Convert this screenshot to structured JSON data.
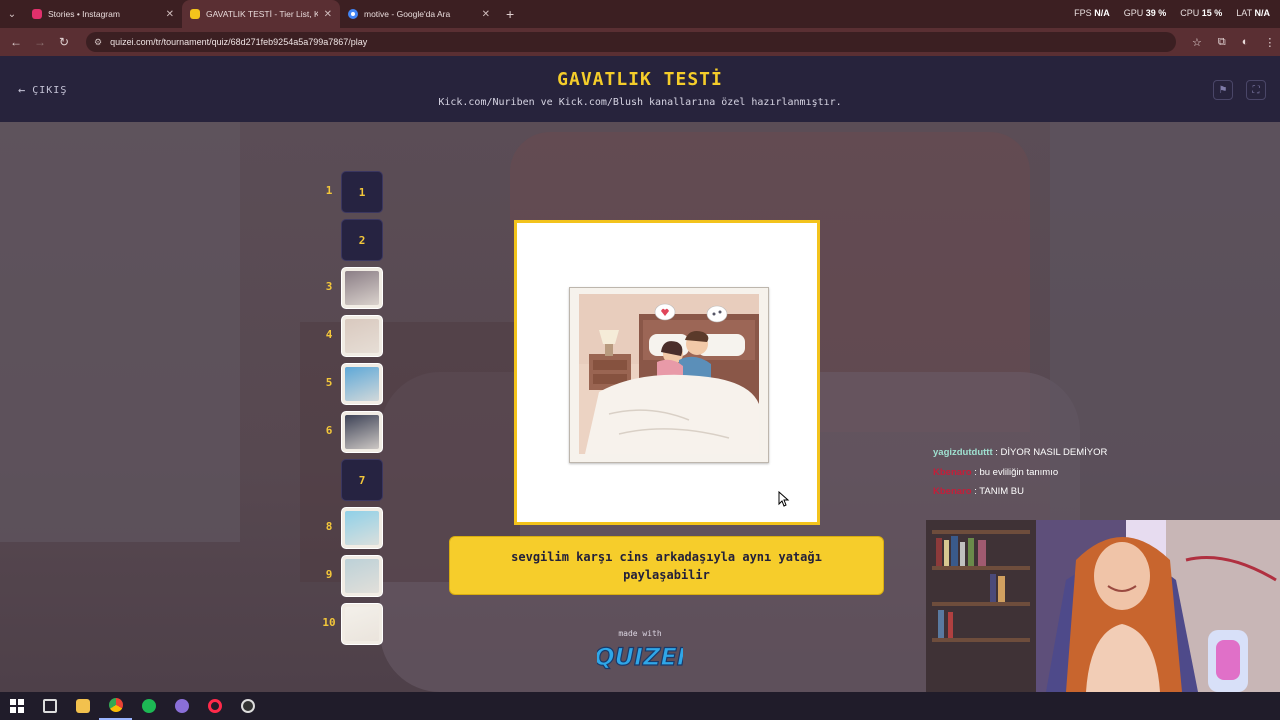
{
  "browser": {
    "tabs": [
      {
        "title": "Stories • Instagram",
        "favicon_color": "#e1306c",
        "active": false
      },
      {
        "title": "GAVATLIK TESTİ - Tier List, Kör",
        "favicon_color": "#f3c31c",
        "active": true
      },
      {
        "title": "motive - Google'da Ara",
        "favicon_color": "#4285f4",
        "active": false
      }
    ],
    "new_tab": "+",
    "url": "quizei.com/tr/tournament/quiz/68d271feb9254a5a799a7867/play",
    "hud": {
      "fps_label": "FPS",
      "fps_value": "N/A",
      "gpu_label": "GPU",
      "gpu_value": "39 %",
      "cpu_label": "CPU",
      "cpu_value": "15 %",
      "lat_label": "LAT",
      "lat_value": "N/A"
    }
  },
  "page": {
    "exit_label": "ÇIKIŞ",
    "title": "GAVATLIK TESTİ",
    "subtitle": "Kick.com/Nuriben ve Kick.com/Blush kanallarına özel hazırlanmıştır.",
    "ranks": [
      {
        "num": "1",
        "box_text": "1",
        "filled": false
      },
      {
        "num": "",
        "box_text": "2",
        "filled": false
      },
      {
        "num": "3",
        "box_text": "",
        "filled": true,
        "thumb_color": "#8b7e86"
      },
      {
        "num": "4",
        "box_text": "",
        "filled": true,
        "thumb_color": "#d9c9bf"
      },
      {
        "num": "5",
        "box_text": "",
        "filled": true,
        "thumb_color": "#5ea8d8"
      },
      {
        "num": "6",
        "box_text": "",
        "filled": true,
        "thumb_color": "#3d4256"
      },
      {
        "num": "",
        "box_text": "7",
        "filled": false
      },
      {
        "num": "8",
        "box_text": "",
        "filled": true,
        "thumb_color": "#8fd0e8"
      },
      {
        "num": "9",
        "box_text": "",
        "filled": true,
        "thumb_color": "#bcd1d8"
      },
      {
        "num": "10",
        "box_text": "",
        "filled": true,
        "thumb_color": "#f3f0ea"
      }
    ],
    "caption": "sevgilim karşı cins arkadaşıyla aynı yatağı paylaşabilir",
    "made_with": "made with",
    "brand": "QUIZEI",
    "accent_color": "#f6cd2b",
    "header_bg": "#27233c"
  },
  "chat": [
    {
      "user": "yagizdutduttt",
      "user_color": "#9fe0d0",
      "message": ": DİYOR NASIL DEMİYOR"
    },
    {
      "user": "Kbenaro",
      "user_color": "#c41e3a",
      "message": ": bu evliliğin tanımıo"
    },
    {
      "user": "Kbenaro",
      "user_color": "#c41e3a",
      "message": ": TANIM BU"
    }
  ],
  "taskbar": {
    "apps": [
      "windows-start",
      "task-view",
      "file-explorer",
      "chrome",
      "spotify",
      "discord",
      "opera-gx",
      "obs"
    ]
  }
}
